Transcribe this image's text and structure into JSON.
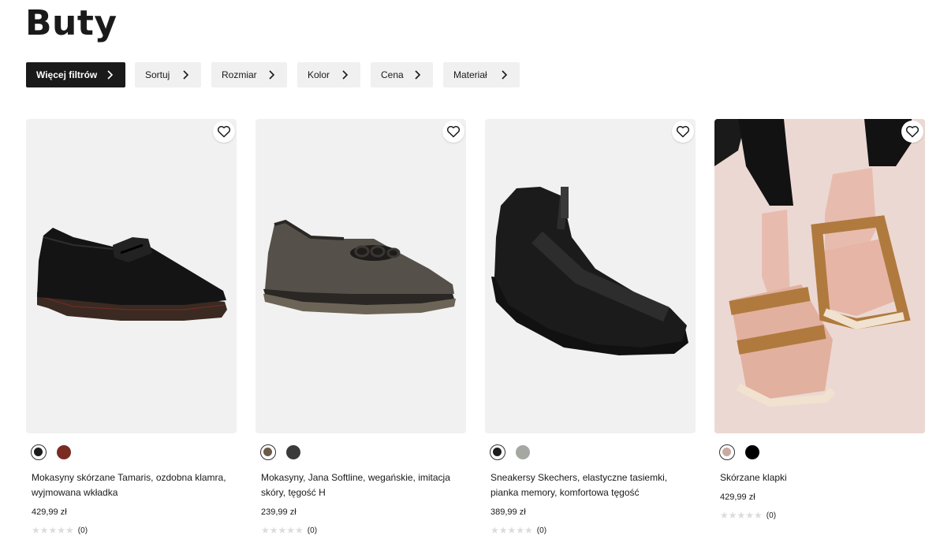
{
  "page": {
    "title": "Buty"
  },
  "filters": [
    {
      "label": "Więcej filtrów"
    },
    {
      "label": "Sortuj"
    },
    {
      "label": "Rozmiar"
    },
    {
      "label": "Kolor"
    },
    {
      "label": "Cena"
    },
    {
      "label": "Materiał"
    }
  ],
  "products": [
    {
      "title": "Mokasyny skórzane Tamaris, ozdobna klamra, wyjmowana wkładka",
      "price": "429,99 zł",
      "rating_count": "(0)",
      "stars": "★★★★★",
      "swatches": [
        {
          "color": "#1c1c1c",
          "selected": true
        },
        {
          "color": "#7a2b22",
          "selected": false
        }
      ]
    },
    {
      "title": "Mokasyny, Jana Softline, wegańskie, imitacja skóry, tęgość H",
      "price": "239,99 zł",
      "rating_count": "(0)",
      "stars": "★★★★★",
      "swatches": [
        {
          "color": "#6b5a48",
          "selected": true
        },
        {
          "color": "#3a3a3a",
          "selected": false
        }
      ]
    },
    {
      "title": "Sneakersy Skechers, elastyczne tasiemki, pianka memory, komfortowa tęgość",
      "price": "389,99 zł",
      "rating_count": "(0)",
      "stars": "★★★★★",
      "swatches": [
        {
          "color": "#1c1c1c",
          "selected": true
        },
        {
          "color": "#a4a8a0",
          "selected": false
        }
      ]
    },
    {
      "title": "Skórzane klapki",
      "price": "429,99 zł",
      "rating_count": "(0)",
      "stars": "★★★★★",
      "swatches": [
        {
          "color": "#c9aaa0",
          "selected": true
        },
        {
          "color": "#000000",
          "selected": false
        }
      ]
    }
  ],
  "icons": {
    "favorite": "heart-icon",
    "chevron": "chevron-right-icon"
  }
}
